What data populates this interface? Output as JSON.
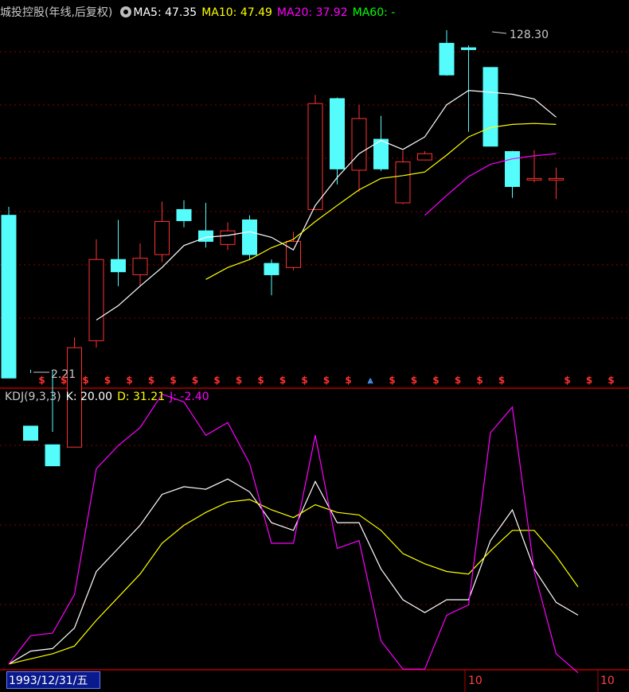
{
  "header": {
    "title": "城投控股(年线,后复权)",
    "ma": [
      {
        "label": "MA5: 47.35",
        "color": "#ffffff"
      },
      {
        "label": "MA10: 47.49",
        "color": "#ffff00"
      },
      {
        "label": "MA20: 37.92",
        "color": "#ff00ff"
      },
      {
        "label": "MA60: -",
        "color": "#00ff00"
      }
    ]
  },
  "kdj_header": {
    "title": "KDJ(9,3,3)",
    "items": [
      {
        "label": "K: 20.00",
        "color": "#ffffff"
      },
      {
        "label": "D: 31.21",
        "color": "#ffff00"
      },
      {
        "label": "J: -2.40",
        "color": "#ff00ff"
      }
    ]
  },
  "footer": {
    "date": "1993/12/31/五",
    "tick_labels": [
      "10",
      "10"
    ]
  },
  "colors": {
    "up": "#ff3232",
    "down": "#54fcfc",
    "grid": "#8b0000",
    "k": "#ffffff",
    "d": "#ffff00",
    "j": "#ff00ff"
  },
  "chart_data": [
    {
      "type": "candlestick",
      "annotations": [
        {
          "text": "128.30",
          "kind": "max"
        },
        {
          "text": "2.21",
          "kind": "min"
        }
      ],
      "candles": [
        {
          "o": 56,
          "c": 8,
          "h": 62,
          "l": 7
        },
        {
          "o": 4.5,
          "c": 3.8,
          "h": 8.5,
          "l": 0
        },
        {
          "o": 3.6,
          "c": 2.8,
          "h": 4.2,
          "l": 2.21
        },
        {
          "o": 3.5,
          "c": 11.5,
          "h": 13,
          "l": 2.5
        },
        {
          "o": 12.5,
          "c": 33,
          "h": 42,
          "l": 11.5
        },
        {
          "o": 33,
          "c": 28.5,
          "h": 53,
          "l": 24
        },
        {
          "o": 27.5,
          "c": 33.5,
          "h": 40,
          "l": 24
        },
        {
          "o": 35,
          "c": 52,
          "h": 66,
          "l": 32
        },
        {
          "o": 60,
          "c": 52.5,
          "h": 67,
          "l": 48.5
        },
        {
          "o": 46.5,
          "c": 41,
          "h": 65,
          "l": 38
        },
        {
          "o": 39.5,
          "c": 46.5,
          "h": 51.5,
          "l": 37
        },
        {
          "o": 53,
          "c": 35,
          "h": 56,
          "l": 33
        },
        {
          "o": 31.5,
          "c": 27.5,
          "h": 33,
          "l": 21.5
        },
        {
          "o": 30,
          "c": 41,
          "h": 46,
          "l": 29
        },
        {
          "o": 60,
          "c": 213,
          "h": 236,
          "l": 61
        },
        {
          "o": 226,
          "c": 97.5,
          "h": 229,
          "l": 81
        },
        {
          "o": 96,
          "c": 178,
          "h": 210,
          "l": 74
        },
        {
          "o": 139,
          "c": 97.5,
          "h": 184,
          "l": 95
        },
        {
          "o": 65,
          "c": 106,
          "h": 121,
          "l": 64
        },
        {
          "o": 108.5,
          "c": 117,
          "h": 120.5,
          "l": 108
        },
        {
          "o": 438,
          "c": 300,
          "h": 512,
          "l": 297
        },
        {
          "o": 415,
          "c": 406,
          "h": 427,
          "l": 152
        },
        {
          "o": 328,
          "c": 128,
          "h": 328,
          "l": 128
        },
        {
          "o": 120,
          "c": 79,
          "h": 121,
          "l": 69
        },
        {
          "o": 87,
          "c": 87,
          "h": 122,
          "l": 83
        },
        {
          "o": 87,
          "c": 87,
          "h": 99,
          "l": 68
        }
      ],
      "ma5": [
        null,
        null,
        null,
        null,
        16,
        19,
        24,
        30,
        39,
        43,
        44,
        46,
        43,
        37,
        63,
        88,
        117,
        137,
        123,
        143,
        210,
        249,
        244,
        238,
        225,
        181
      ],
      "ma10": [
        null,
        null,
        null,
        null,
        null,
        null,
        null,
        null,
        null,
        26,
        30,
        33,
        38,
        42,
        52,
        63,
        76,
        87,
        90,
        94,
        115,
        143,
        160,
        166,
        168,
        166
      ],
      "ma20": [
        null,
        null,
        null,
        null,
        null,
        null,
        null,
        null,
        null,
        null,
        null,
        null,
        null,
        null,
        null,
        null,
        null,
        null,
        null,
        56,
        71,
        89,
        103,
        110,
        114,
        117
      ],
      "flags": [
        1,
        1,
        1,
        1,
        1,
        1,
        1,
        1,
        1,
        1,
        1,
        1,
        1,
        1,
        1,
        2,
        1,
        1,
        1,
        1,
        1,
        1,
        0,
        0,
        1,
        1,
        1
      ]
    },
    {
      "type": "line",
      "series": [
        {
          "name": "K",
          "values": [
            1,
            6,
            7,
            15,
            37,
            46,
            55,
            67,
            70,
            69,
            73,
            68,
            56,
            53,
            72,
            56,
            56,
            38,
            26,
            21,
            26,
            26,
            49,
            61,
            38,
            25,
            20
          ]
        },
        {
          "name": "D",
          "values": [
            1,
            3,
            5,
            8,
            18,
            27,
            36,
            48,
            55,
            60,
            64,
            65,
            61,
            58,
            63,
            60,
            59,
            53,
            44,
            40,
            37,
            36,
            45,
            53,
            53,
            43,
            31
          ]
        },
        {
          "name": "J",
          "values": [
            1,
            12,
            13,
            28,
            77,
            86,
            93,
            106,
            103,
            90,
            95,
            79,
            48,
            48,
            90,
            46,
            49,
            10,
            -1,
            -1,
            20,
            24,
            91,
            101,
            37,
            5,
            -2.4
          ]
        }
      ],
      "ylim": [
        0,
        100
      ]
    }
  ]
}
